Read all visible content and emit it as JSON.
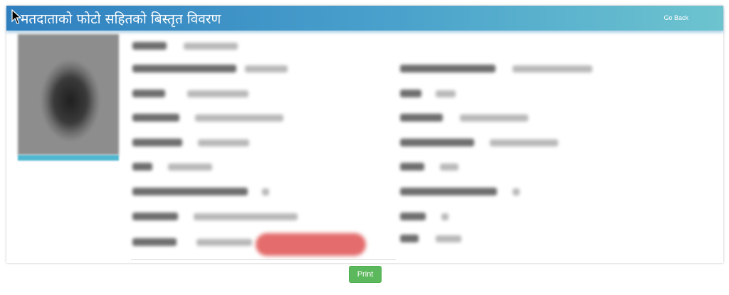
{
  "header": {
    "title": "मतदाताको फोटो सहितको बिस्तृत विवरण",
    "go_back_label": "Go Back"
  },
  "actions": {
    "print_label": "Print"
  },
  "colors": {
    "header_start": "#2f7fbf",
    "header_end": "#6dc4cf",
    "print_button": "#5cb85c",
    "status_pill": "#e46c6c"
  },
  "icons": {
    "cursor": "mouse-pointer-icon"
  }
}
